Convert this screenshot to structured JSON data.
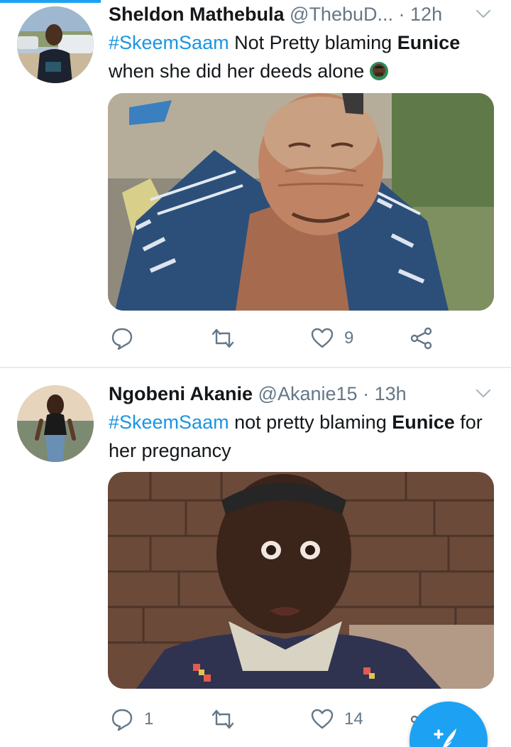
{
  "accent_color": "#1da1f2",
  "tweets": [
    {
      "display_name": "Sheldon Mathebula",
      "handle": "@ThebuD...",
      "separator": "·",
      "time": "12h",
      "text": {
        "hashtag": "#SkeemSaam",
        "part1": " Not Pretty blaming ",
        "bold": "Eunice",
        "part2": " when she did her deeds alone"
      },
      "emoji_icon": "person-facepalming-icon",
      "media": "photo-older-man-smiling-plaid-shirt",
      "actions": {
        "reply": "",
        "retweet": "",
        "like": "9",
        "share": ""
      }
    },
    {
      "display_name": "Ngobeni Akanie",
      "handle": "@Akanie15",
      "separator": "·",
      "time": "13h",
      "text": {
        "hashtag": "#SkeemSaam",
        "part1": " not pretty blaming ",
        "bold": "Eunice",
        "part2": " for her pregnancy"
      },
      "media": "photo-man-shocked-wide-eyes",
      "actions": {
        "reply": "1",
        "retweet": "",
        "like": "14",
        "share": ""
      }
    }
  ],
  "fab": {
    "icon": "compose-tweet-icon"
  }
}
